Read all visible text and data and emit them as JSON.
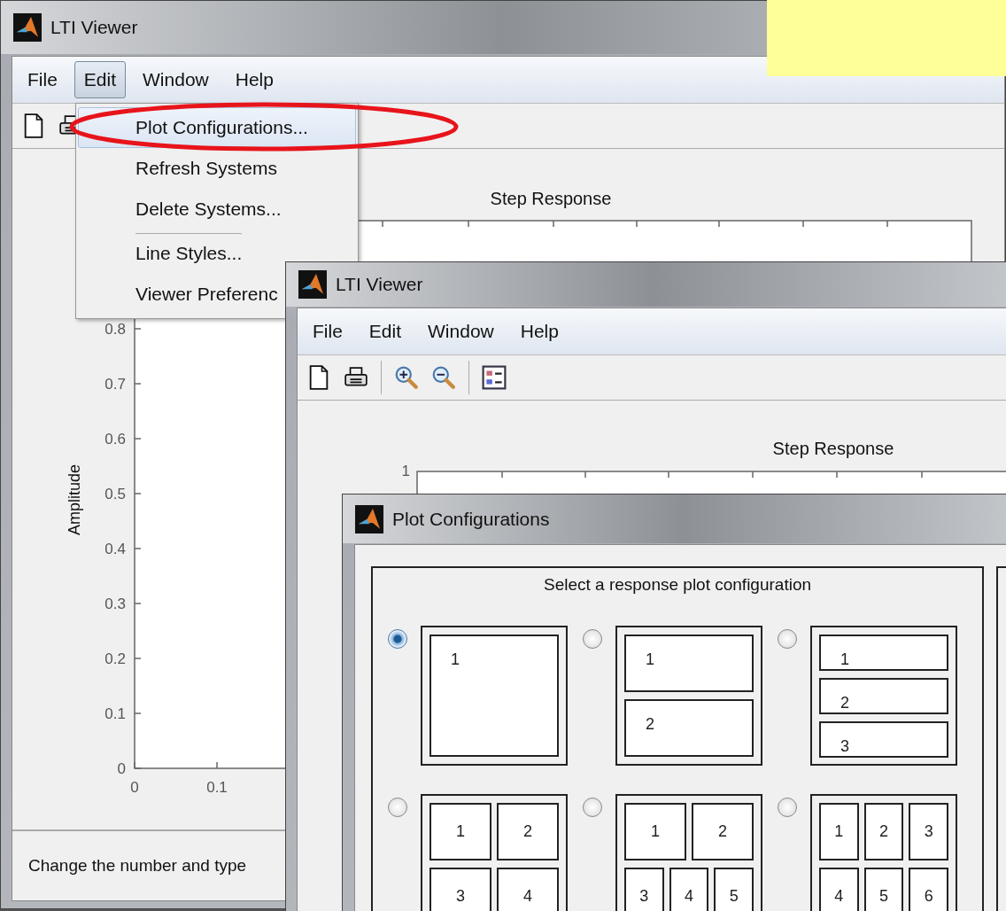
{
  "back_window": {
    "title": "LTI Viewer",
    "menu": [
      {
        "label": "File",
        "selected": false
      },
      {
        "label": "Edit",
        "selected": true
      },
      {
        "label": "Window",
        "selected": false
      },
      {
        "label": "Help",
        "selected": false
      }
    ],
    "edit_menu": [
      {
        "label": "Plot Configurations...",
        "selected": true,
        "separator_before": false
      },
      {
        "label": "Refresh Systems",
        "selected": false,
        "separator_before": false
      },
      {
        "label": "Delete Systems...",
        "selected": false,
        "separator_before": false
      },
      {
        "label": "Line Styles...",
        "selected": false,
        "separator_before": true
      },
      {
        "label": "Viewer Preferenc",
        "selected": false,
        "separator_before": false
      }
    ],
    "plot": {
      "title": "Step Response",
      "ylabel": "Amplitude",
      "yticks": [
        "0.8",
        "0.7",
        "0.6",
        "0.5",
        "0.4",
        "0.3",
        "0.2",
        "0.1",
        "0"
      ],
      "xticks": [
        "0",
        "0.1"
      ]
    },
    "status_bar": "Change the number and type"
  },
  "front_window": {
    "title": "LTI Viewer",
    "menu": [
      "File",
      "Edit",
      "Window",
      "Help"
    ],
    "plot": {
      "title": "Step Response",
      "yticks": [
        "1"
      ]
    }
  },
  "dialog": {
    "title": "Plot Configurations",
    "heading": "Select a response plot configuration",
    "options": [
      {
        "selected": true,
        "rows": [
          [
            "1"
          ]
        ]
      },
      {
        "selected": false,
        "rows": [
          [
            "1"
          ],
          [
            "2"
          ]
        ]
      },
      {
        "selected": false,
        "rows": [
          [
            "1"
          ],
          [
            "2"
          ],
          [
            "3"
          ]
        ]
      },
      {
        "selected": false,
        "rows": [
          [
            "1",
            "2"
          ],
          [
            "3",
            "4"
          ]
        ]
      },
      {
        "selected": false,
        "rows": [
          [
            "1",
            "2"
          ],
          [
            "3",
            "4",
            "5"
          ]
        ]
      },
      {
        "selected": false,
        "rows": [
          [
            "1",
            "2",
            "3"
          ],
          [
            "4",
            "5",
            "6"
          ]
        ]
      }
    ]
  }
}
